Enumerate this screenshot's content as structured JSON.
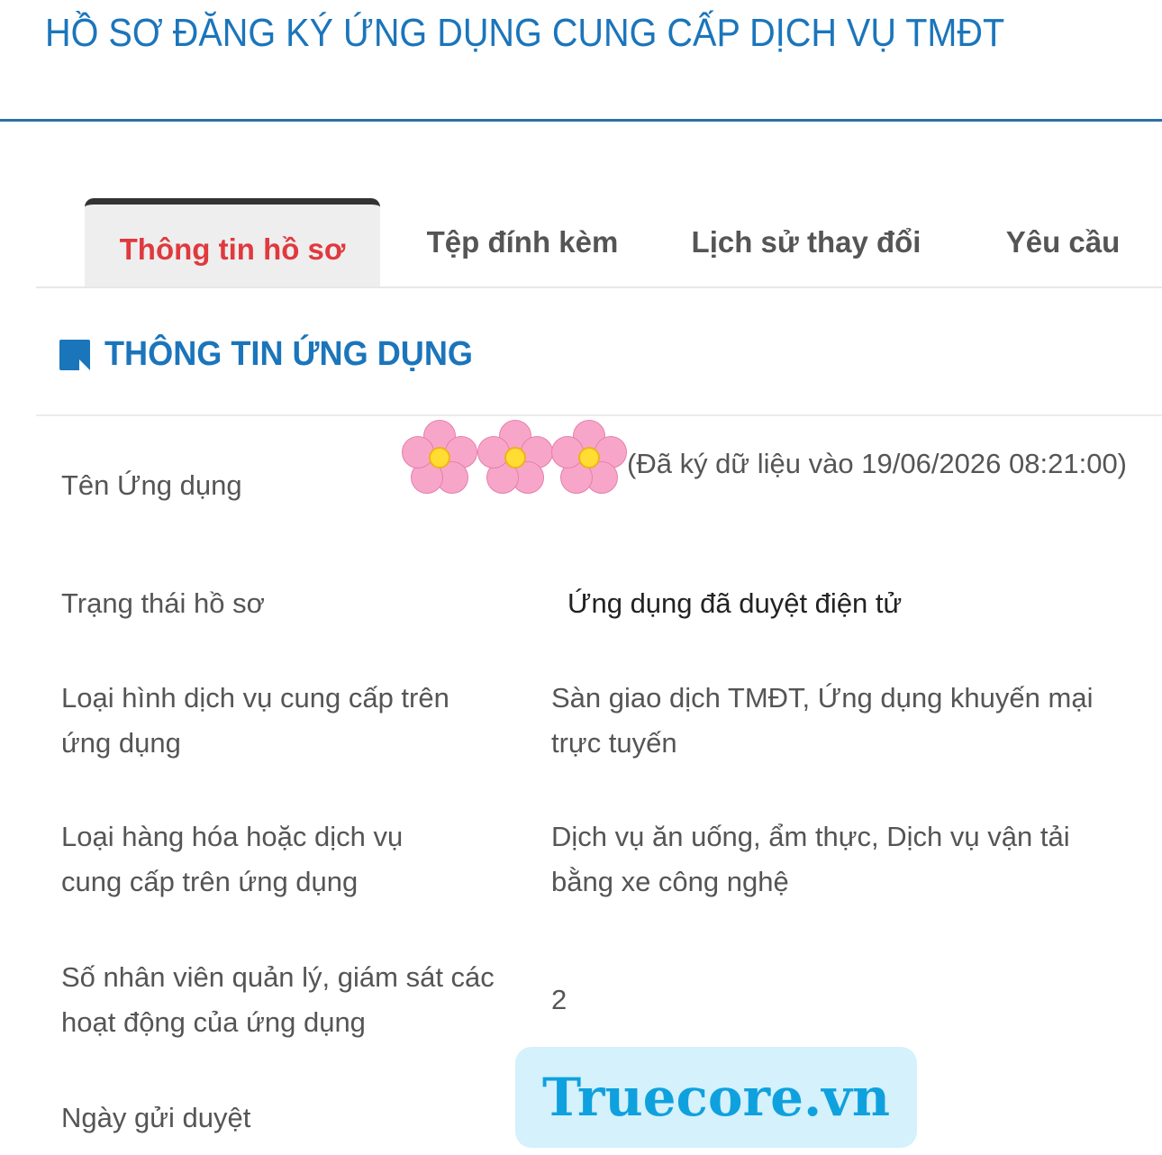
{
  "page": {
    "title": "HỒ SƠ ĐĂNG KÝ ỨNG DỤNG CUNG CẤP DỊCH VỤ TMĐT"
  },
  "tabs": [
    {
      "label": "Thông tin hồ sơ",
      "active": true
    },
    {
      "label": "Tệp đính kèm",
      "active": false
    },
    {
      "label": "Lịch sử thay đổi",
      "active": false
    },
    {
      "label": "Yêu cầu",
      "active": false
    }
  ],
  "section": {
    "title": "THÔNG TIN ỨNG DỤNG",
    "icon": "note-edit-icon"
  },
  "fields": [
    {
      "label": "Tên Ứng dụng",
      "value": "(Đã ký dữ liệu vào 19/06/2026 08:21:00)"
    },
    {
      "label": "Trạng thái hồ sơ",
      "value": "Ứng dụng đã duyệt điện tử"
    },
    {
      "label": "Loại hình dịch vụ cung cấp trên ứng dụng",
      "value": "Sàn giao dịch TMĐT, Ứng dụng khuyến mại trực tuyến"
    },
    {
      "label": "Loại hàng hóa hoặc dịch vụ cung cấp trên ứng dụng",
      "value": "Dịch vụ ăn uống, ẩm thực, Dịch vụ vận tải bằng xe công nghệ"
    },
    {
      "label": "Số nhân viên quản lý, giám sát các hoạt động của ứng dụng",
      "value": "2"
    },
    {
      "label": "Ngày gửi duyệt",
      "value": ""
    }
  ],
  "overlay": {
    "redaction_icon": "cherry-blossom-icon",
    "watermark_text": "Truecore.vn"
  },
  "colors": {
    "title_blue": "#1b75bb",
    "active_tab_red": "#e0393e",
    "watermark_bg": "#d4f1fc",
    "watermark_text": "#0fa1de"
  }
}
